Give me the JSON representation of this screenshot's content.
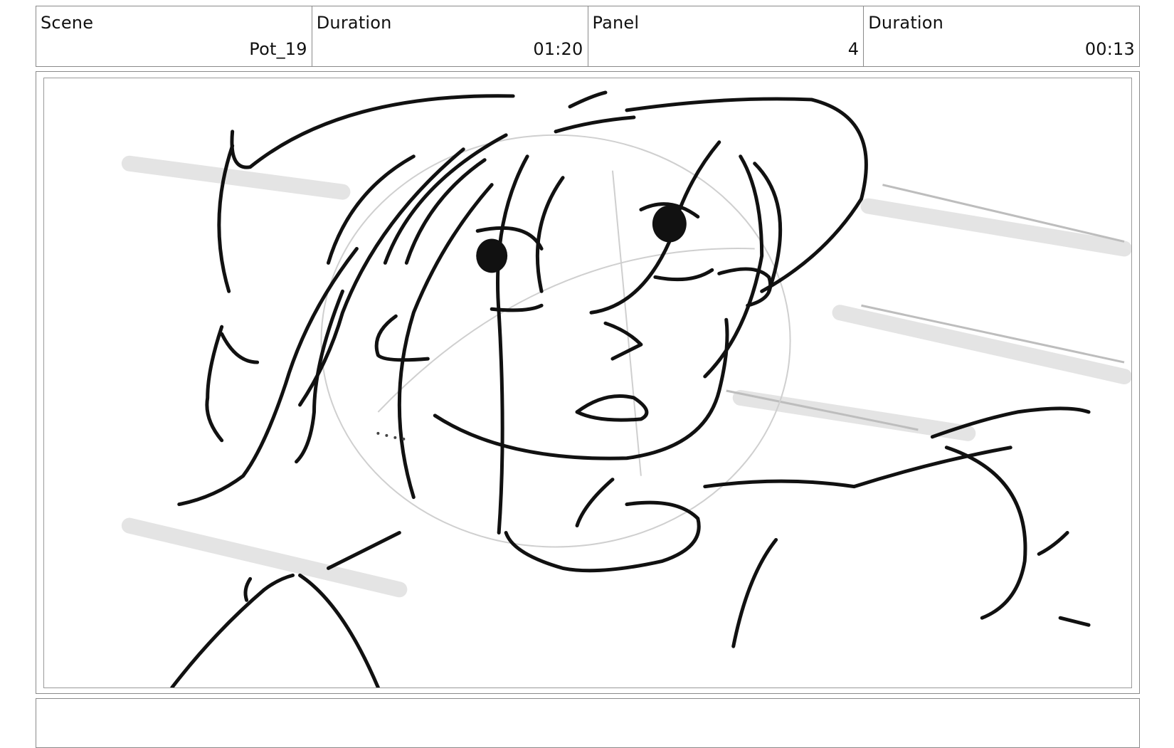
{
  "header": {
    "scene": {
      "label": "Scene",
      "value": "Pot_19"
    },
    "scene_duration": {
      "label": "Duration",
      "value": "01:20"
    },
    "panel": {
      "label": "Panel",
      "value": "4"
    },
    "panel_duration": {
      "label": "Duration",
      "value": "00:13"
    }
  },
  "notes": {
    "text": ""
  },
  "colors": {
    "line": "#111111",
    "sketch": "#c8c8c8",
    "border": "#8a8a8a"
  }
}
